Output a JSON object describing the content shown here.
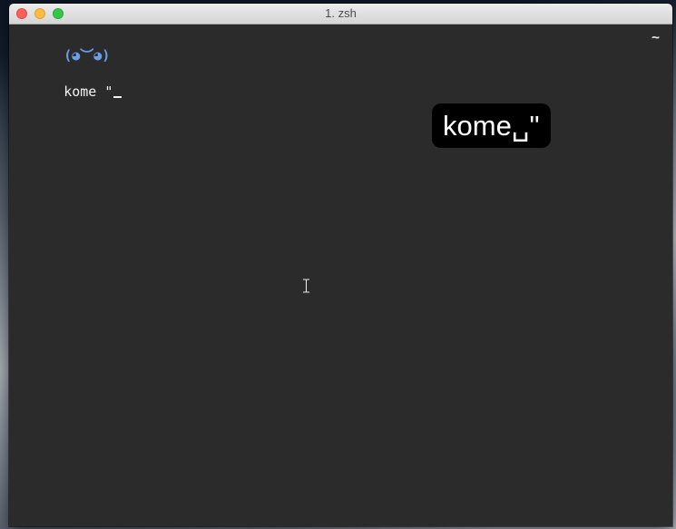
{
  "window": {
    "title": "1. zsh"
  },
  "terminal": {
    "prompt": "(◕︶◕)",
    "command": "kome \"",
    "cwd": "~"
  },
  "keystroke_overlay": {
    "text": "kome␣\""
  },
  "colors": {
    "terminal_background": "#2b2b2b",
    "prompt_color": "#6d9eea",
    "text_color": "#e8e8e8",
    "overlay_background": "#000000"
  },
  "icons": [
    "close-button",
    "minimize-button",
    "zoom-button",
    "text-cursor-icon"
  ]
}
